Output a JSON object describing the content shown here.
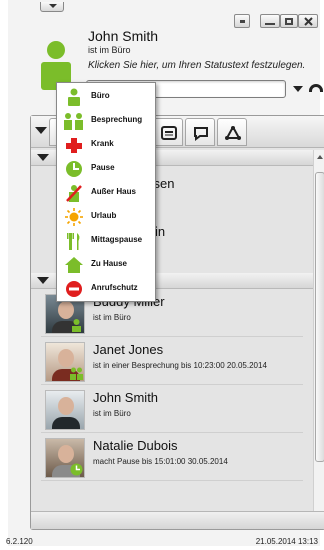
{
  "user": {
    "name": "John Smith",
    "location": "ist im Büro",
    "status_hint": "Klicken Sie hier, um Ihren Statustext festzulegen.",
    "status_value": ""
  },
  "status_menu": {
    "items": [
      {
        "label": "Büro",
        "icon": "office-person-icon",
        "color": "#7bbd2a"
      },
      {
        "label": "Besprechung",
        "icon": "meeting-icon",
        "color": "#7bbd2a"
      },
      {
        "label": "Krank",
        "icon": "sick-cross-icon",
        "color": "#e01e1e"
      },
      {
        "label": "Pause",
        "icon": "pause-clock-icon",
        "color": "#7bbd2a"
      },
      {
        "label": "Außer Haus",
        "icon": "out-of-office-icon",
        "color": "#e01e1e"
      },
      {
        "label": "Urlaub",
        "icon": "vacation-sun-icon",
        "color": "#f5a400"
      },
      {
        "label": "Mittagspause",
        "icon": "lunch-cutlery-icon",
        "color": "#7bbd2a"
      },
      {
        "label": "Zu Hause",
        "icon": "home-icon",
        "color": "#7bbd2a"
      },
      {
        "label": "Anrufschutz",
        "icon": "do-not-disturb-icon",
        "color": "#e01e1e"
      }
    ]
  },
  "partial_names": [
    "ssen",
    "rtin"
  ],
  "contacts": [
    {
      "name": "Buddy Miller",
      "status": "ist im Büro"
    },
    {
      "name": "Janet Jones",
      "status": "ist in einer Besprechung bis 10:23:00 20.05.2014"
    },
    {
      "name": "John Smith",
      "status": "ist im Büro"
    },
    {
      "name": "Natalie Dubois",
      "status": "macht Pause bis 15:01:00 30.05.2014"
    }
  ],
  "footer": {
    "version": "6.2.120",
    "datetime": "21.05.2014 13:13"
  },
  "colors": {
    "presence_green": "#7bbd2a",
    "alert_red": "#e01e1e"
  }
}
